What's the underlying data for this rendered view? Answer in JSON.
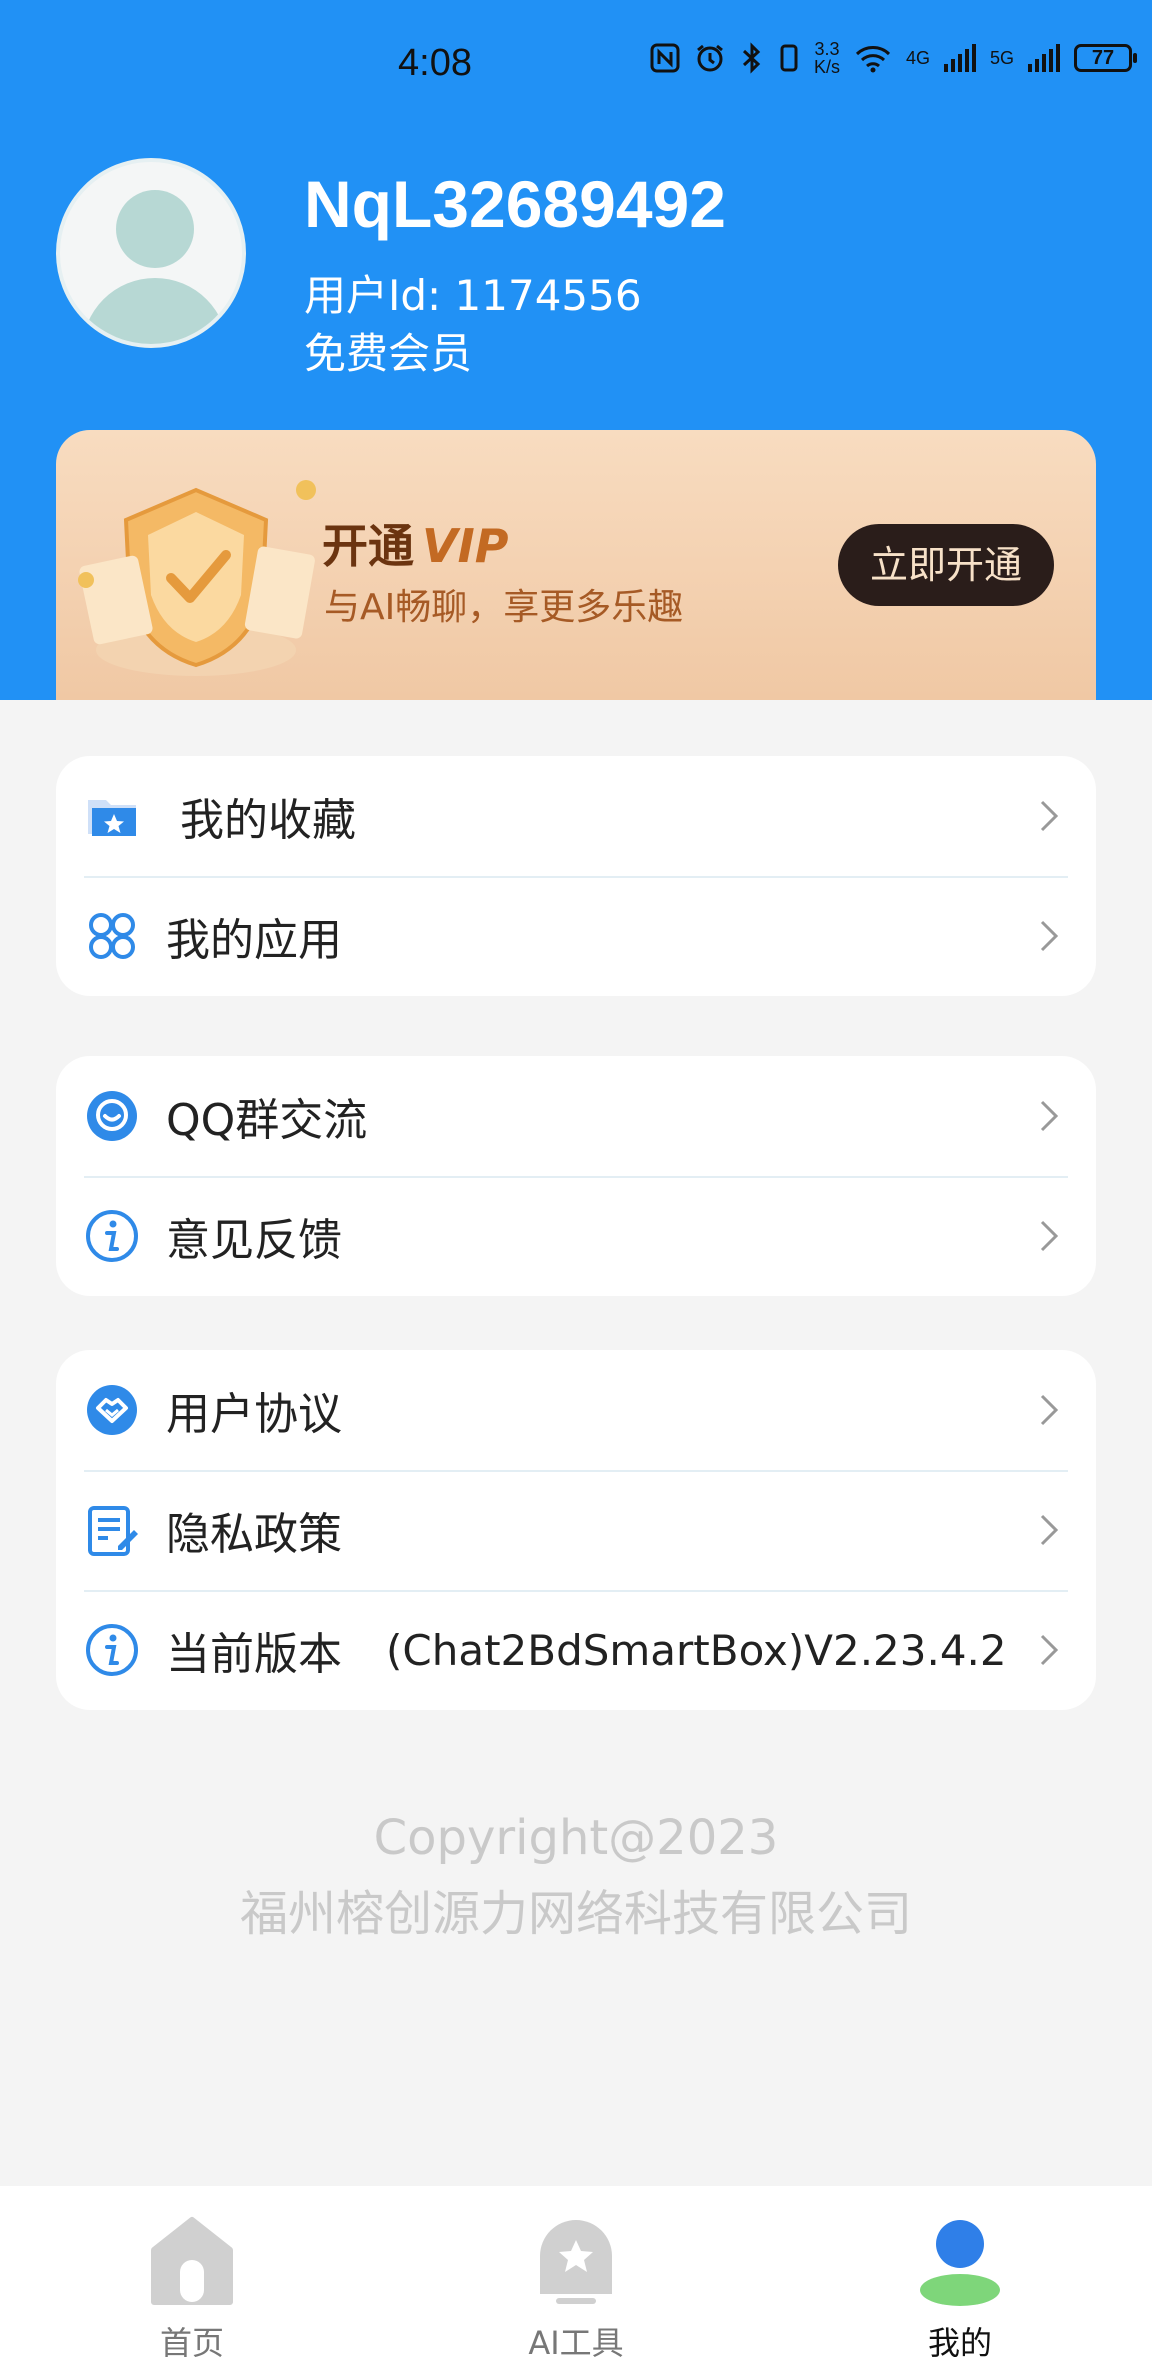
{
  "status_bar": {
    "time": "4:08",
    "network_speed_value": "3.3",
    "network_speed_unit": "K/s",
    "network_4g": "4G",
    "network_5g": "5G",
    "battery": "77"
  },
  "profile": {
    "username": "NqL32689492",
    "user_id": "用户Id: 1174556",
    "membership": "免费会员"
  },
  "vip_banner": {
    "title": "开通",
    "vip_word": "VIP",
    "subtitle": "与AI畅聊，享更多乐趣",
    "button_label": "立即开通"
  },
  "menu_groups": [
    {
      "items": [
        {
          "icon": "folder-star-icon",
          "label": "我的收藏"
        },
        {
          "icon": "apps-icon",
          "label": "我的应用"
        }
      ]
    },
    {
      "items": [
        {
          "icon": "chat-bubble-icon",
          "label": "QQ群交流"
        },
        {
          "icon": "info-icon",
          "label": "意见反馈"
        }
      ]
    },
    {
      "items": [
        {
          "icon": "handshake-icon",
          "label": "用户协议"
        },
        {
          "icon": "document-edit-icon",
          "label": "隐私政策"
        },
        {
          "icon": "info-icon",
          "label": "当前版本",
          "value": "(Chat2BdSmartBox)V2.23.4.2"
        }
      ]
    }
  ],
  "footer": {
    "copyright": "Copyright@2023",
    "company": "福州榕创源力网络科技有限公司"
  },
  "bottom_nav": {
    "items": [
      {
        "icon": "home-icon",
        "label": "首页"
      },
      {
        "icon": "ai-tools-icon",
        "label": "AI工具"
      },
      {
        "icon": "profile-icon",
        "label": "我的",
        "active": true
      }
    ]
  },
  "colors": {
    "header_blue": "#2191f5",
    "accent_blue": "#2f8ae8",
    "vip_button": "#2a1d1a"
  }
}
